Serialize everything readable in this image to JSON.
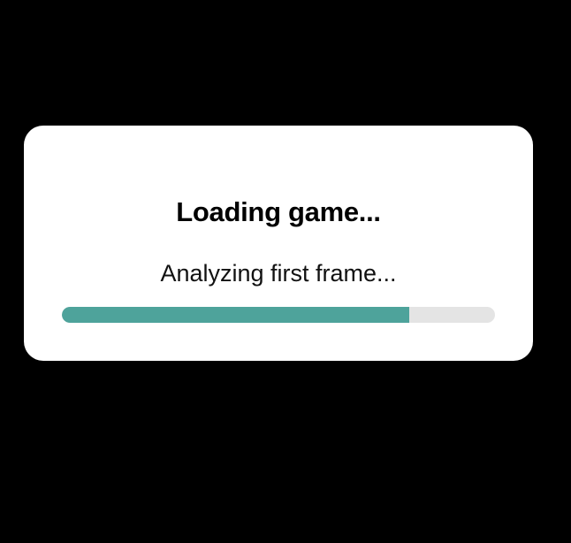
{
  "loading_dialog": {
    "title": "Loading game...",
    "status": "Analyzing first frame...",
    "progress": 0.802
  },
  "colors": {
    "background": "#000000",
    "dialog": "#ffffff",
    "progress_fill": "#4ea39b",
    "progress_track": "#e4e4e4"
  }
}
